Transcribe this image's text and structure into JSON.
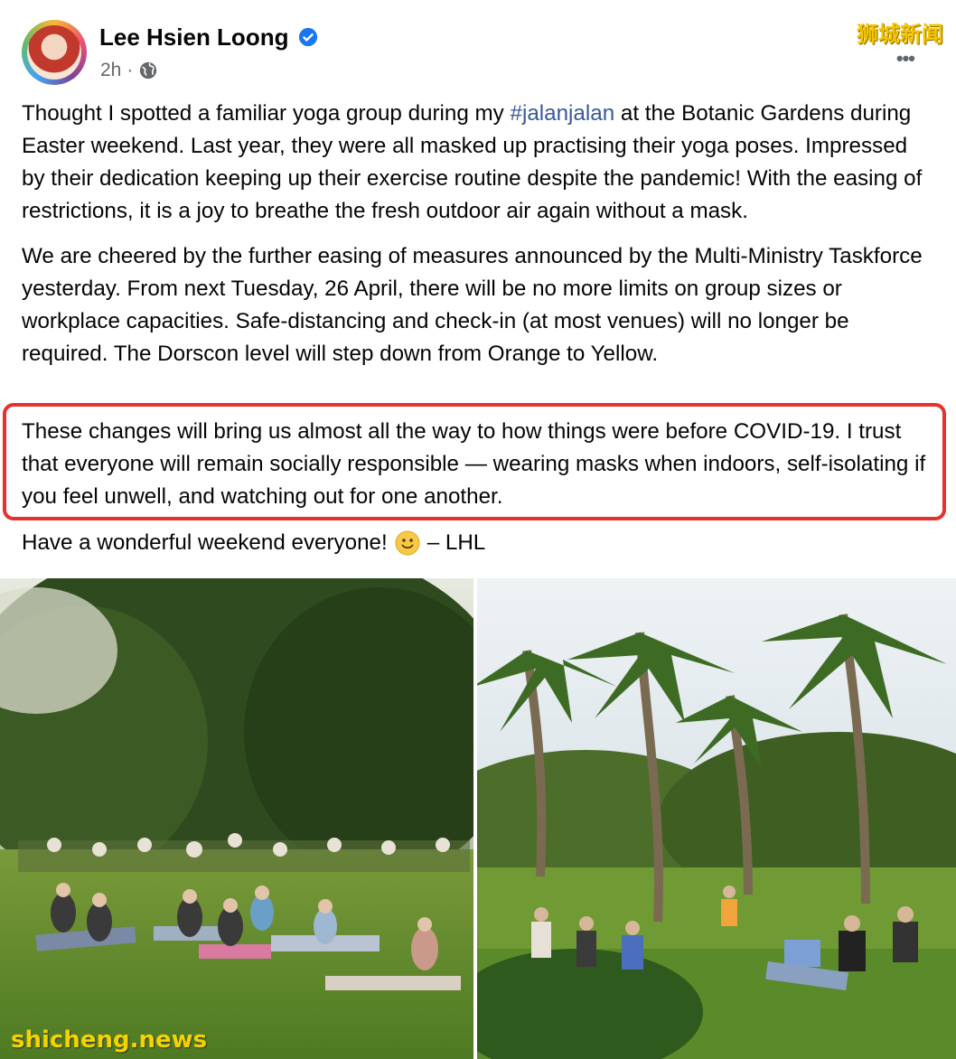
{
  "post": {
    "author": "Lee Hsien Loong",
    "time": "2h",
    "separator": "·",
    "more_label": "•••",
    "paragraphs": {
      "p1_before": "Thought I spotted a familiar yoga group during my ",
      "p1_hashtag": "#jalanjalan",
      "p1_after": " at the Botanic Gardens during Easter weekend. Last year, they were all masked up practising their yoga poses. Impressed by their dedication keeping up their exercise routine despite the pandemic! With the easing of restrictions, it is a joy to breathe the fresh outdoor air again without a mask.",
      "p2": "We are cheered by the further easing of measures announced by the Multi-Ministry Taskforce yesterday. From next Tuesday, 26 April, there will be no more limits on group sizes or workplace capacities. Safe-distancing and check-in (at most venues) will no longer be required. The Dorscon level will step down from Orange to Yellow.",
      "p3_highlighted": "These changes will bring us almost all the way to how things were before COVID-19. I trust that everyone will remain socially responsible — wearing masks when indoors, self-isolating if you feel unwell, and watching out for one another.",
      "p4_before": "Have a wonderful weekend everyone!",
      "p4_after": "– LHL"
    }
  },
  "watermarks": {
    "top_right": "狮城新闻",
    "bottom_left": "shicheng.news"
  },
  "colors": {
    "hashtag": "#385898",
    "highlight_border": "#e5322d",
    "verified_badge": "#1877f2",
    "meta_gray": "#65676b"
  },
  "icons": [
    "verified-badge-icon",
    "globe-icon",
    "smiley-emoji-icon",
    "more-options-icon"
  ]
}
